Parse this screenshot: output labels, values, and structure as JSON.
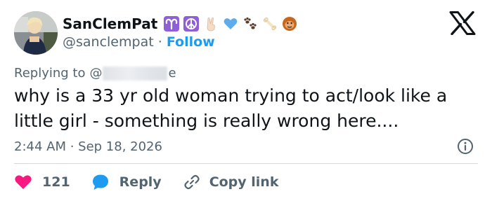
{
  "author": {
    "display_name": "SanClemPat",
    "handle": "@sanclempat",
    "separator": "·",
    "follow_label": "Follow",
    "name_badges": [
      "aries-icon",
      "peace-icon",
      "victory-hand-icon",
      "blue-heart-icon",
      "paw-prints-icon",
      "bone-icon",
      "orangutan-icon"
    ]
  },
  "reply": {
    "prefix": "Replying to",
    "mention_start": "@",
    "mention_end": "e"
  },
  "tweet": {
    "text": "why is a 33 yr old woman trying to act/look like a little girl - something is really wrong here....",
    "timestamp": "2:44 AM · Sep 18, 2026"
  },
  "actions": {
    "like_count": "121",
    "reply_label": "Reply",
    "copy_label": "Copy link"
  },
  "colors": {
    "brand_blue": "#1d9bf0",
    "like_red": "#f91880",
    "text_primary": "#0f1419",
    "text_secondary": "#536471",
    "divider": "#cfd9de",
    "badge_purple": "#8f5fd6"
  }
}
